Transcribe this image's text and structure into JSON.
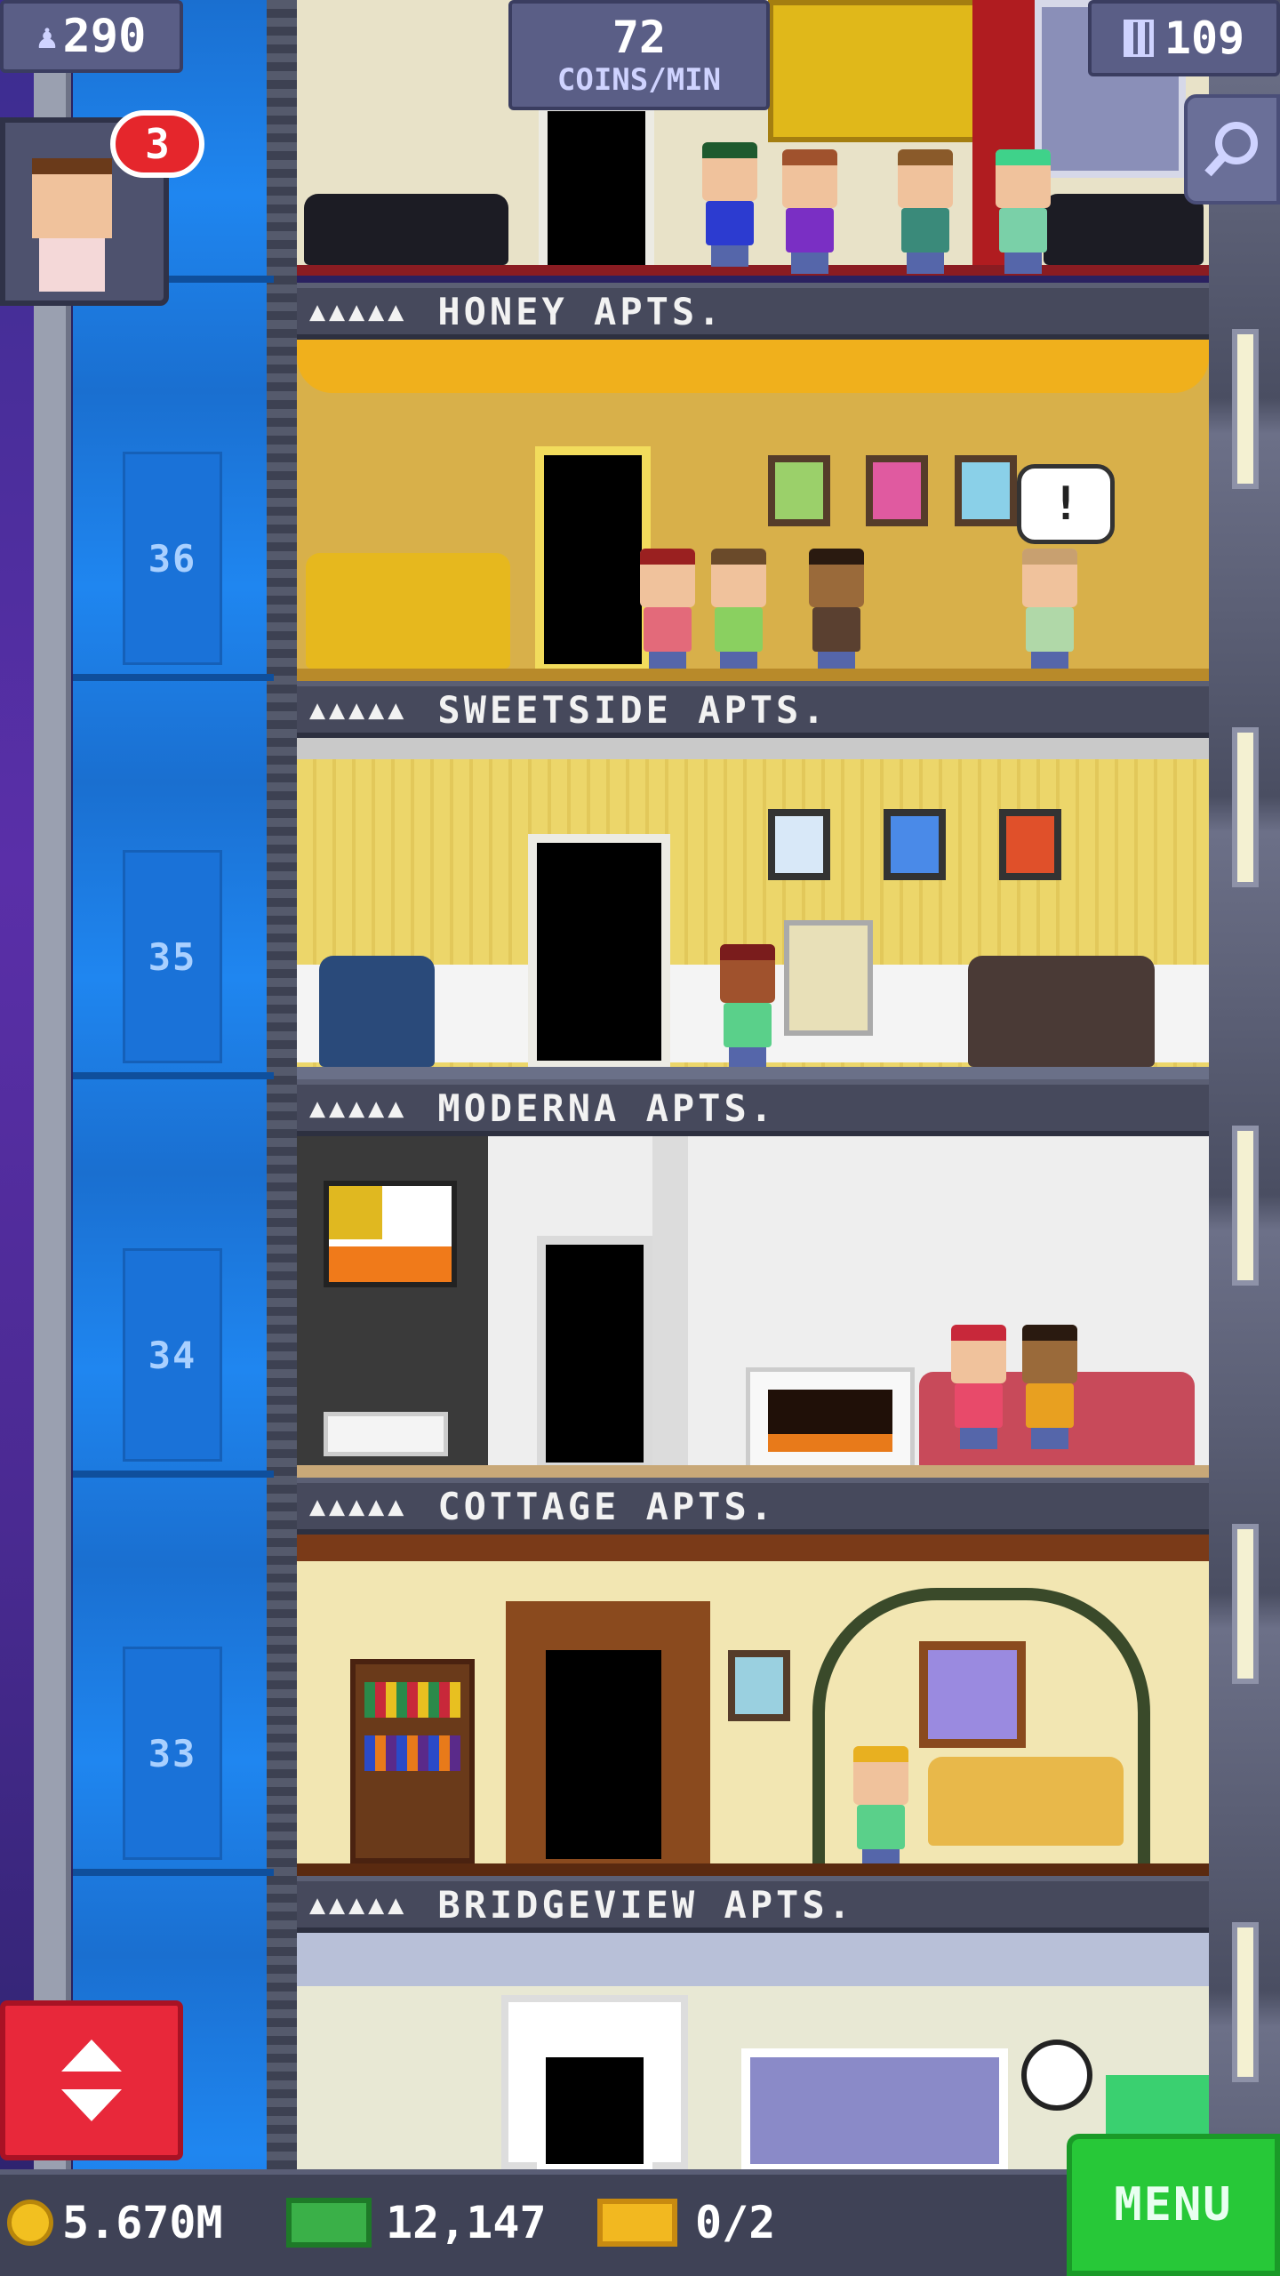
{
  "hud": {
    "population": "290",
    "coins_per_min_value": "72",
    "coins_per_min_unit": "COINS/MIN",
    "floor_count": "109",
    "visitor_badge_count": "3"
  },
  "floors": [
    {
      "name": "HONEY APTS.",
      "people_icons": "▲▲▲▲▲"
    },
    {
      "name": "SWEETSIDE APTS.",
      "people_icons": "▲▲▲▲▲"
    },
    {
      "name": "MODERNA APTS.",
      "people_icons": "▲▲▲▲▲"
    },
    {
      "name": "COTTAGE APTS.",
      "people_icons": "▲▲▲▲▲"
    },
    {
      "name": "BRIDGEVIEW APTS.",
      "people_icons": "▲▲▲▲▲"
    }
  ],
  "shaft_floor_numbers": [
    "36",
    "35",
    "34",
    "33"
  ],
  "bottom_bar": {
    "coins": "5.670M",
    "bux": "12,147",
    "tickets": "0/2",
    "menu_label": "MENU"
  },
  "speech_bubble": "!",
  "colors": {
    "shaft_blue": "#1f86f0",
    "menu_green": "#27c838",
    "badge_red": "#e5262c",
    "elevator_red": "#e8283a",
    "hud_purple": "#5a5e86"
  },
  "icons": {
    "population": "person-icon",
    "floors": "building-icon",
    "zoom": "magnifier-icon",
    "elevator": "up-down-arrows-icon",
    "coins": "coin-icon",
    "bux": "bux-bill-icon",
    "tickets": "ticket-icon"
  }
}
